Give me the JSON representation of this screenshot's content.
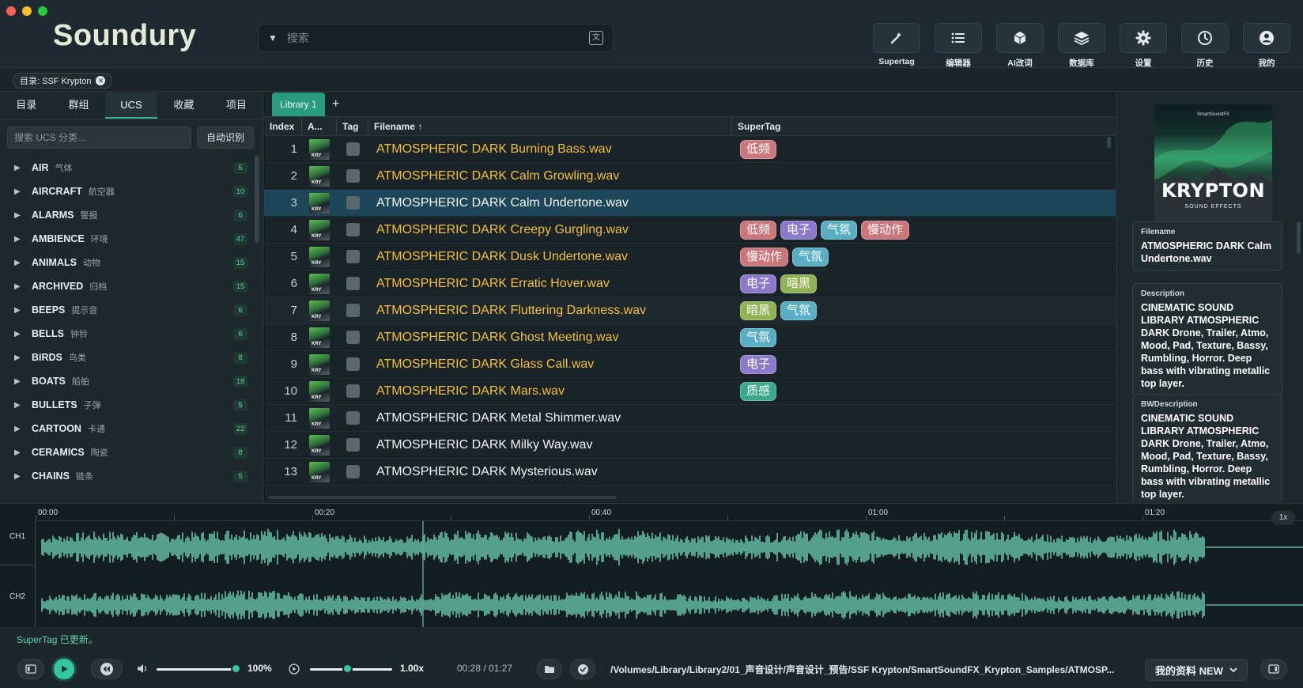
{
  "app": {
    "name": "Soundury"
  },
  "colors": {
    "accent": "#35c79d",
    "file_tagged": "#f2c043",
    "selection": "#1d4658"
  },
  "search": {
    "placeholder": "搜索",
    "caret": "▼",
    "translate_icon": "translate-icon"
  },
  "toolbar": [
    {
      "label": "Supertag",
      "icon": "magic-wand-icon"
    },
    {
      "label": "编辑器",
      "icon": "list-icon"
    },
    {
      "label": "AI改词",
      "icon": "cube-icon"
    },
    {
      "label": "数据库",
      "icon": "layers-icon"
    },
    {
      "label": "设置",
      "icon": "gear-icon"
    },
    {
      "label": "历史",
      "icon": "history-icon"
    },
    {
      "label": "我的",
      "icon": "user-icon"
    }
  ],
  "path_chip": {
    "label": "目录: SSF Krypton"
  },
  "sidebar": {
    "tabs": [
      "目录",
      "群组",
      "UCS",
      "收藏",
      "项目"
    ],
    "active_tab": "UCS",
    "filter_placeholder": "搜索 UCS 分类...",
    "auto_button": "自动识别",
    "items": [
      {
        "en": "AIR",
        "cn": "气体",
        "count": "5"
      },
      {
        "en": "AIRCRAFT",
        "cn": "航空器",
        "count": "10"
      },
      {
        "en": "ALARMS",
        "cn": "警报",
        "count": "6"
      },
      {
        "en": "AMBIENCE",
        "cn": "环境",
        "count": "47"
      },
      {
        "en": "ANIMALS",
        "cn": "动物",
        "count": "15"
      },
      {
        "en": "ARCHIVED",
        "cn": "归档",
        "count": "15"
      },
      {
        "en": "BEEPS",
        "cn": "提示音",
        "count": "6"
      },
      {
        "en": "BELLS",
        "cn": "钟铃",
        "count": "6"
      },
      {
        "en": "BIRDS",
        "cn": "鸟类",
        "count": "8"
      },
      {
        "en": "BOATS",
        "cn": "船舶",
        "count": "18"
      },
      {
        "en": "BULLETS",
        "cn": "子弹",
        "count": "5"
      },
      {
        "en": "CARTOON",
        "cn": "卡通",
        "count": "22"
      },
      {
        "en": "CERAMICS",
        "cn": "陶瓷",
        "count": "8"
      },
      {
        "en": "CHAINS",
        "cn": "链条",
        "count": "5"
      }
    ]
  },
  "library": {
    "tabs": [
      "Library 1"
    ],
    "add": "+",
    "columns": [
      "Index",
      "A...",
      "Tag",
      "Filename ↑",
      "SuperTag"
    ],
    "rows": [
      {
        "index": "1",
        "filename": "ATMOSPHERIC DARK Burning Bass.wav",
        "tagged": true,
        "supertags": [
          "低频"
        ]
      },
      {
        "index": "2",
        "filename": "ATMOSPHERIC DARK Calm Growling.wav",
        "tagged": true,
        "supertags": []
      },
      {
        "index": "3",
        "filename": "ATMOSPHERIC DARK Calm Undertone.wav",
        "tagged": false,
        "selected": true,
        "supertags": []
      },
      {
        "index": "4",
        "filename": "ATMOSPHERIC DARK Creepy Gurgling.wav",
        "tagged": true,
        "supertags": [
          "低频",
          "电子",
          "气氛",
          "慢动作"
        ]
      },
      {
        "index": "5",
        "filename": "ATMOSPHERIC DARK Dusk Undertone.wav",
        "tagged": true,
        "supertags": [
          "慢动作",
          "气氛"
        ]
      },
      {
        "index": "6",
        "filename": "ATMOSPHERIC DARK Erratic Hover.wav",
        "tagged": true,
        "supertags": [
          "电子",
          "暗黑"
        ]
      },
      {
        "index": "7",
        "filename": "ATMOSPHERIC DARK Fluttering Darkness.wav",
        "tagged": true,
        "alt": true,
        "supertags": [
          "暗黑",
          "气氛"
        ]
      },
      {
        "index": "8",
        "filename": "ATMOSPHERIC DARK Ghost Meeting.wav",
        "tagged": true,
        "supertags": [
          "气氛"
        ]
      },
      {
        "index": "9",
        "filename": "ATMOSPHERIC DARK Glass Call.wav",
        "tagged": true,
        "supertags": [
          "电子"
        ]
      },
      {
        "index": "10",
        "filename": "ATMOSPHERIC DARK Mars.wav",
        "tagged": true,
        "supertags": [
          "质感"
        ]
      },
      {
        "index": "11",
        "filename": "ATMOSPHERIC DARK Metal Shimmer.wav",
        "tagged": false,
        "supertags": []
      },
      {
        "index": "12",
        "filename": "ATMOSPHERIC DARK Milky Way.wav",
        "tagged": false,
        "supertags": []
      },
      {
        "index": "13",
        "filename": "ATMOSPHERIC DARK Mysterious.wav",
        "tagged": false,
        "supertags": []
      }
    ],
    "tag_colors": {
      "低频": "#c9777a",
      "电子": "#8a7ac9",
      "气氛": "#5aaec4",
      "慢动作": "#c9777a",
      "暗黑": "#8fb352",
      "质感": "#3aa98a"
    }
  },
  "details": {
    "cover": {
      "brand": "SmartSoundFX",
      "title": "KRYPTON",
      "subtitle": "SOUND EFFECTS"
    },
    "filename_label": "Filename",
    "filename": "ATMOSPHERIC DARK Calm Undertone.wav",
    "description_label": "Description",
    "description": "CINEMATIC SOUND LIBRARY ATMOSPHERIC DARK Drone, Trailer, Atmo, Mood, Pad, Texture, Bassy, Rumbling, Horror. Deep bass with vibrating metallic top layer.",
    "bwdescription_label": "BWDescription",
    "bwdescription": "CINEMATIC SOUND LIBRARY ATMOSPHERIC DARK Drone, Trailer, Atmo, Mood, Pad, Texture, Bassy, Rumbling, Horror. Deep bass with vibrating metallic top layer."
  },
  "waveform": {
    "ticks": [
      "00:00",
      "00:20",
      "00:40",
      "01:00",
      "01:20"
    ],
    "channels": [
      "CH1",
      "CH2"
    ],
    "zoom": "1x",
    "duration_seconds": 87,
    "position_seconds": 28
  },
  "status": {
    "message": "SuperTag 已更新。"
  },
  "transport": {
    "volume": "100%",
    "volume_level": 1.0,
    "speed": "1.00x",
    "speed_level": 0.45,
    "time": "00:28 / 01:27",
    "path": "/Volumes/Library/Library2/01_声音设计/声音设计_预告/SSF Krypton/SmartSoundFX_Krypton_Samples/ATMOSP...",
    "profile": "我的资料 NEW"
  }
}
